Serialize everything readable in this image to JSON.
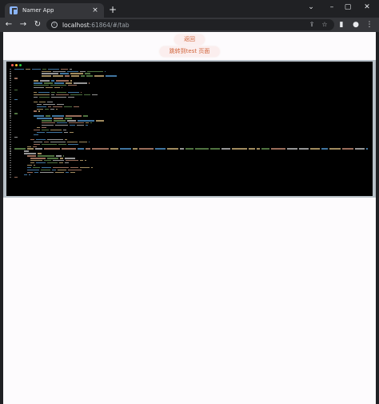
{
  "browser": {
    "tab_title": "Namer App",
    "tab_close": "×",
    "new_tab": "+",
    "url_host": "localhost",
    "url_rest": ":61864/#/tab",
    "controls": {
      "menu": "⌄",
      "minimize": "–",
      "maximize": "▢",
      "close": "✕"
    },
    "nav": {
      "back": "←",
      "forward": "→",
      "reload": "↻"
    },
    "icons": {
      "share": "⇪",
      "bookmark": "☆",
      "sidebar": "▮",
      "profile": "●",
      "menu": "⋮"
    }
  },
  "page": {
    "back_button": "返回",
    "goto_button": "跳转到test 页面"
  },
  "colors": {
    "code_text": "#c8c8c8",
    "code_string": "#d7ba7d",
    "code_keyword": "#569cd6",
    "code_accent": "#ce9178",
    "code_green": "#6a9955",
    "dot_red": "#ff5f56",
    "dot_yellow": "#ffbd2e",
    "dot_green": "#27c93f"
  }
}
